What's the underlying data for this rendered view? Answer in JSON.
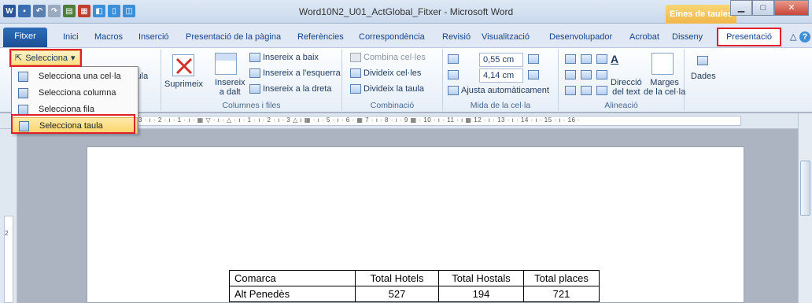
{
  "window": {
    "title": "Word10N2_U01_ActGlobal_Fitxer - Microsoft Word",
    "contextual_tools": "Eines de taules",
    "minimize_glyph": "▁",
    "maximize_glyph": "□",
    "close_glyph": "✕"
  },
  "quick_access": [
    {
      "icon": "word-logo-icon",
      "glyph": "W",
      "color": "#2b579a"
    },
    {
      "icon": "save-icon",
      "glyph": "▪",
      "color": "#3b6db3"
    },
    {
      "icon": "undo-icon",
      "glyph": "↶",
      "color": "#5b7fb0"
    },
    {
      "icon": "redo-icon",
      "glyph": "↷",
      "color": "#9aabbf"
    },
    {
      "icon": "print-icon",
      "glyph": "▤",
      "color": "#4f7d3a"
    },
    {
      "icon": "table-icon",
      "glyph": "▦",
      "color": "#c03f2f"
    },
    {
      "icon": "preview-icon",
      "glyph": "◧",
      "color": "#3d8fd8"
    },
    {
      "icon": "new-doc-icon",
      "glyph": "▯",
      "color": "#3d8fd8"
    },
    {
      "icon": "page-icon",
      "glyph": "◫",
      "color": "#3d8fd8"
    }
  ],
  "tabs": {
    "file": "Fitxer",
    "items": [
      "Inici",
      "Macros",
      "Inserció",
      "Presentació de la pàgina",
      "Referències",
      "Correspondència",
      "Revisió",
      "Visualització",
      "Desenvolupador",
      "Acrobat",
      "Disseny",
      "Presentació"
    ],
    "help_glyph": "?",
    "minimize_ribbon_glyph": "△"
  },
  "ribbon": {
    "selecciona": "Selecciona",
    "graella_partial": "ícula",
    "suprimeix": "Suprimeix",
    "insereix_dalt_1": "Insereix",
    "insereix_dalt_2": "a dalt",
    "insereix_baix": "Insereix a baix",
    "insereix_esquerra": "Insereix a l'esquerra",
    "insereix_dreta": "Insereix a la dreta",
    "group_columns_rows": "Columnes i files",
    "combina": "Combina cel·les",
    "divideix_celles": "Divideix cel·les",
    "divideix_taula": "Divideix la taula",
    "group_combinacio": "Combinació",
    "height_value": "0,55 cm",
    "width_value": "4,14 cm",
    "ajusta": "Ajusta automàticament",
    "group_mida": "Mida de la cel·la",
    "direccio_1": "Direcció",
    "direccio_2": "del text",
    "marges_1": "Marges",
    "marges_2": "de la cel·la",
    "group_alineacio": "Alineació",
    "dades": "Dades"
  },
  "menu": {
    "items": [
      "Selecciona una cel·la",
      "Selecciona columna",
      "Selecciona fila",
      "Selecciona taula"
    ],
    "selected_index": 3
  },
  "ruler": {
    "h_text": "3 · ı · 2 · ı · 1 · ı · ▦ ▽ · ı · △ · ı · 1 · ı · 2 · ı · 3 △ ı ▦ · ı · 5 · ı · 6 · ▦ 7 · ı · 8 · ı · 9 ▦ · 10 · ı · 11 · ı ▦ 12 · ı · 13 · ı · 14 · ı · 15 · ı · 16 ·",
    "v_text": "2"
  },
  "table": {
    "headers": [
      "Comarca",
      "Total Hotels",
      "Total Hostals",
      "Total places"
    ],
    "rows": [
      [
        "Alt Penedès",
        "527",
        "194",
        "721"
      ]
    ]
  },
  "colors": {
    "highlight_red": "#e0202a",
    "file_tab_blue": "#2b64ad",
    "tools_orange": "#f0b64a"
  }
}
